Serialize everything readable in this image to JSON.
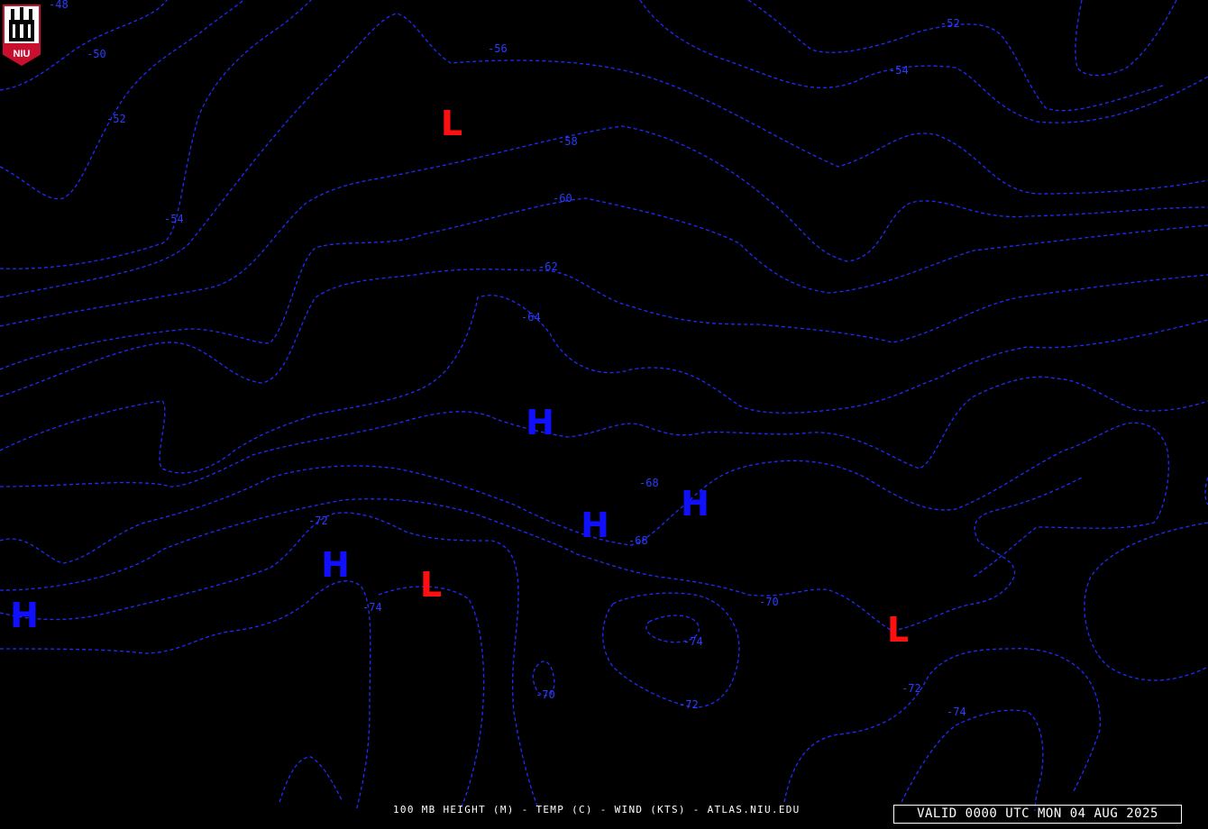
{
  "colors": {
    "background": "#000000",
    "contour": "#1f2cff",
    "contour_label": "#2a3cff",
    "high": "#1010ff",
    "low": "#ff1010",
    "footer_text": "#ffffff",
    "logo_red": "#c8102e"
  },
  "logo": {
    "text": "NIU",
    "icon": "university-tower-logo"
  },
  "map": {
    "contour_labels": [
      "-48",
      "-50",
      "-52",
      "-54",
      "-56",
      "-58",
      "-60",
      "-62",
      "-64",
      "-68",
      "-68",
      "-70",
      "-70",
      "-72",
      "-72",
      "-72",
      "-74",
      "-74",
      "-74",
      "-52",
      "-54"
    ],
    "pressure_centers": [
      {
        "kind": "L"
      },
      {
        "kind": "H"
      },
      {
        "kind": "H"
      },
      {
        "kind": "H"
      },
      {
        "kind": "H"
      },
      {
        "kind": "H"
      },
      {
        "kind": "L"
      },
      {
        "kind": "L"
      }
    ]
  },
  "footer": {
    "caption": "100 MB HEIGHT (M) - TEMP (C) - WIND (KTS) - ATLAS.NIU.EDU",
    "valid": "VALID 0000 UTC MON 04 AUG 2025"
  }
}
